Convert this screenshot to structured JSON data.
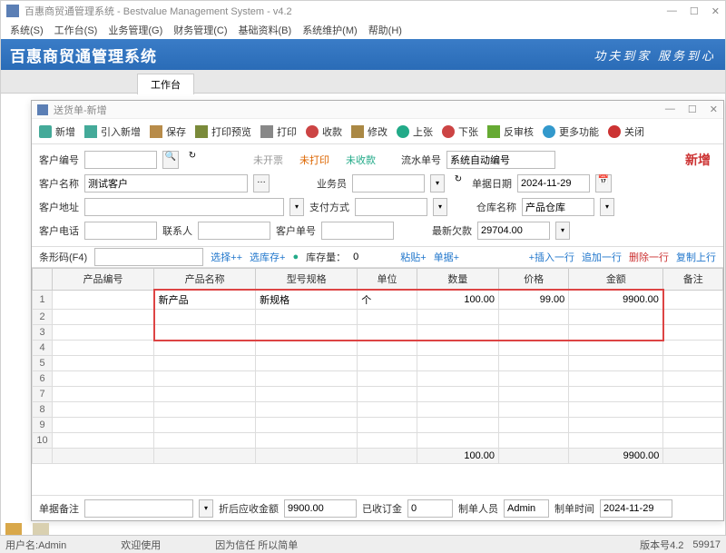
{
  "main": {
    "title": "百惠商贸通管理系统 - Bestvalue Management System - v4.2",
    "menu": [
      "系统(S)",
      "工作台(S)",
      "业务管理(G)",
      "财务管理(C)",
      "基础资料(B)",
      "系统维护(M)",
      "帮助(H)"
    ],
    "banner_title": "百惠商贸通管理系统",
    "banner_slogan": "功夫到家 服务到心",
    "tab": "工作台"
  },
  "modal": {
    "title": "送货单-新增",
    "toolbar": {
      "new": "新增",
      "import": "引入新增",
      "save": "保存",
      "preview": "打印预览",
      "print": "打印",
      "collect": "收款",
      "edit": "修改",
      "up": "上张",
      "down": "下张",
      "audit": "反审核",
      "more": "更多功能",
      "close": "关闭"
    },
    "form": {
      "customer_no_lbl": "客户编号",
      "customer_no": "",
      "status_uninvoiced": "未开票",
      "status_unprinted": "未打印",
      "status_uncollected": "未收款",
      "serial_lbl": "流水单号",
      "serial": "系统自动编号",
      "mode_new": "新增",
      "customer_name_lbl": "客户名称",
      "customer_name": "测试客户",
      "salesman_lbl": "业务员",
      "salesman": "",
      "date_lbl": "单据日期",
      "date": "2024-11-29",
      "addr_lbl": "客户地址",
      "addr": "",
      "pay_lbl": "支付方式",
      "pay": "",
      "warehouse_lbl": "仓库名称",
      "warehouse": "产品仓库",
      "phone_lbl": "客户电话",
      "phone": "",
      "contact_lbl": "联系人",
      "contact": "",
      "custorder_lbl": "客户单号",
      "custorder": "",
      "debt_lbl": "最新欠款",
      "debt": "29704.00"
    },
    "midbar": {
      "barcode_lbl": "条形码(F4)",
      "barcode": "",
      "select_plus": "选择++",
      "select_stock": "选库存+",
      "stock_lbl": "库存量：",
      "stock_val": "0",
      "paste": "粘贴+",
      "single": "单据+",
      "insert_row": "+插入一行",
      "append_row": "追加一行",
      "delete_row": "删除一行",
      "copy_up": "复制上行"
    },
    "grid": {
      "headers": [
        "产品编号",
        "产品名称",
        "型号规格",
        "单位",
        "数量",
        "价格",
        "金额",
        "备注"
      ],
      "rows": [
        {
          "no": "",
          "name": "新产品",
          "spec": "新规格",
          "unit": "个",
          "qty": "100.00",
          "price": "99.00",
          "amount": "9900.00",
          "remark": ""
        }
      ],
      "blank_rows": 9,
      "totals": {
        "qty": "100.00",
        "amount": "9900.00"
      }
    },
    "bottom": {
      "remark_lbl": "单据备注",
      "remark": "",
      "discount_lbl": "折后应收金额",
      "discount": "9900.00",
      "deposit_lbl": "已收订金",
      "deposit": "0",
      "creator_lbl": "制单人员",
      "creator": "Admin",
      "ctime_lbl": "制单时间",
      "ctime": "2024-11-29"
    }
  },
  "status": {
    "user_lbl": "用户名:",
    "user": "Admin",
    "welcome": "欢迎使用",
    "motto": "因为信任 所以简单",
    "ver_lbl": "版本号",
    "ver": "4.2",
    "build": "59917"
  }
}
